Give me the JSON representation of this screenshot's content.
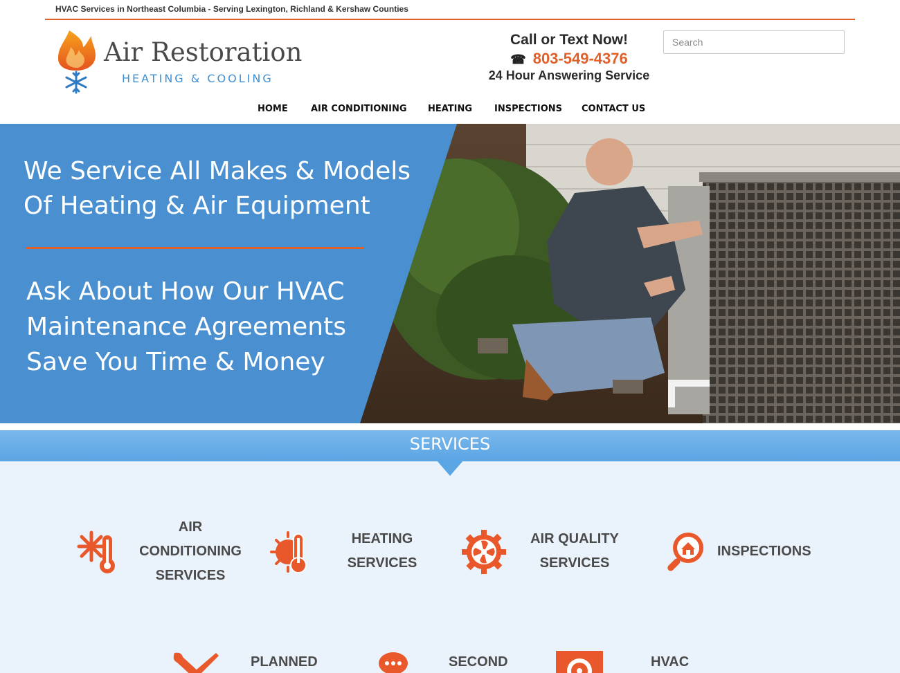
{
  "topbar": {
    "text": "HVAC Services in Northeast Columbia - Serving Lexington, Richland & Kershaw Counties"
  },
  "logo": {
    "name": "Air Restoration",
    "subtitle": "HEATING & COOLING",
    "icon": "flame-snowflake-logo"
  },
  "call": {
    "title": "Call or Text Now!",
    "phone_icon": "phone-icon",
    "phone": "803-549-4376",
    "subtitle": "24 Hour Answering Service"
  },
  "search": {
    "placeholder": "Search",
    "value": ""
  },
  "nav": {
    "items": [
      "HOME",
      "AIR CONDITIONING",
      "HEATING",
      "INSPECTIONS",
      "CONTACT US"
    ]
  },
  "hero": {
    "headline": "We Service All Makes & Models Of Heating & Air Equipment",
    "subheadline": "Ask About How Our HVAC Maintenance Agreements Save You Time & Money"
  },
  "services": {
    "title": "SERVICES",
    "items": [
      {
        "label": "AIR CONDITIONING SERVICES",
        "icon": "snowflake-thermometer-icon"
      },
      {
        "label": "HEATING SERVICES",
        "icon": "sun-thermometer-icon"
      },
      {
        "label": "AIR QUALITY SERVICES",
        "icon": "fan-gear-icon"
      },
      {
        "label": "INSPECTIONS",
        "icon": "house-magnifier-icon"
      },
      {
        "label": "PLANNED",
        "icon": "wrench-screwdriver-icon"
      },
      {
        "label": "SECOND",
        "icon": "chat-bubble-icon"
      },
      {
        "label": "HVAC",
        "icon": "fan-box-icon"
      }
    ]
  },
  "colors": {
    "accent": "#e0602a",
    "brand_blue": "#3f8fd2",
    "hero_blue": "#4a90d0",
    "band_blue": "#6aaee8"
  }
}
